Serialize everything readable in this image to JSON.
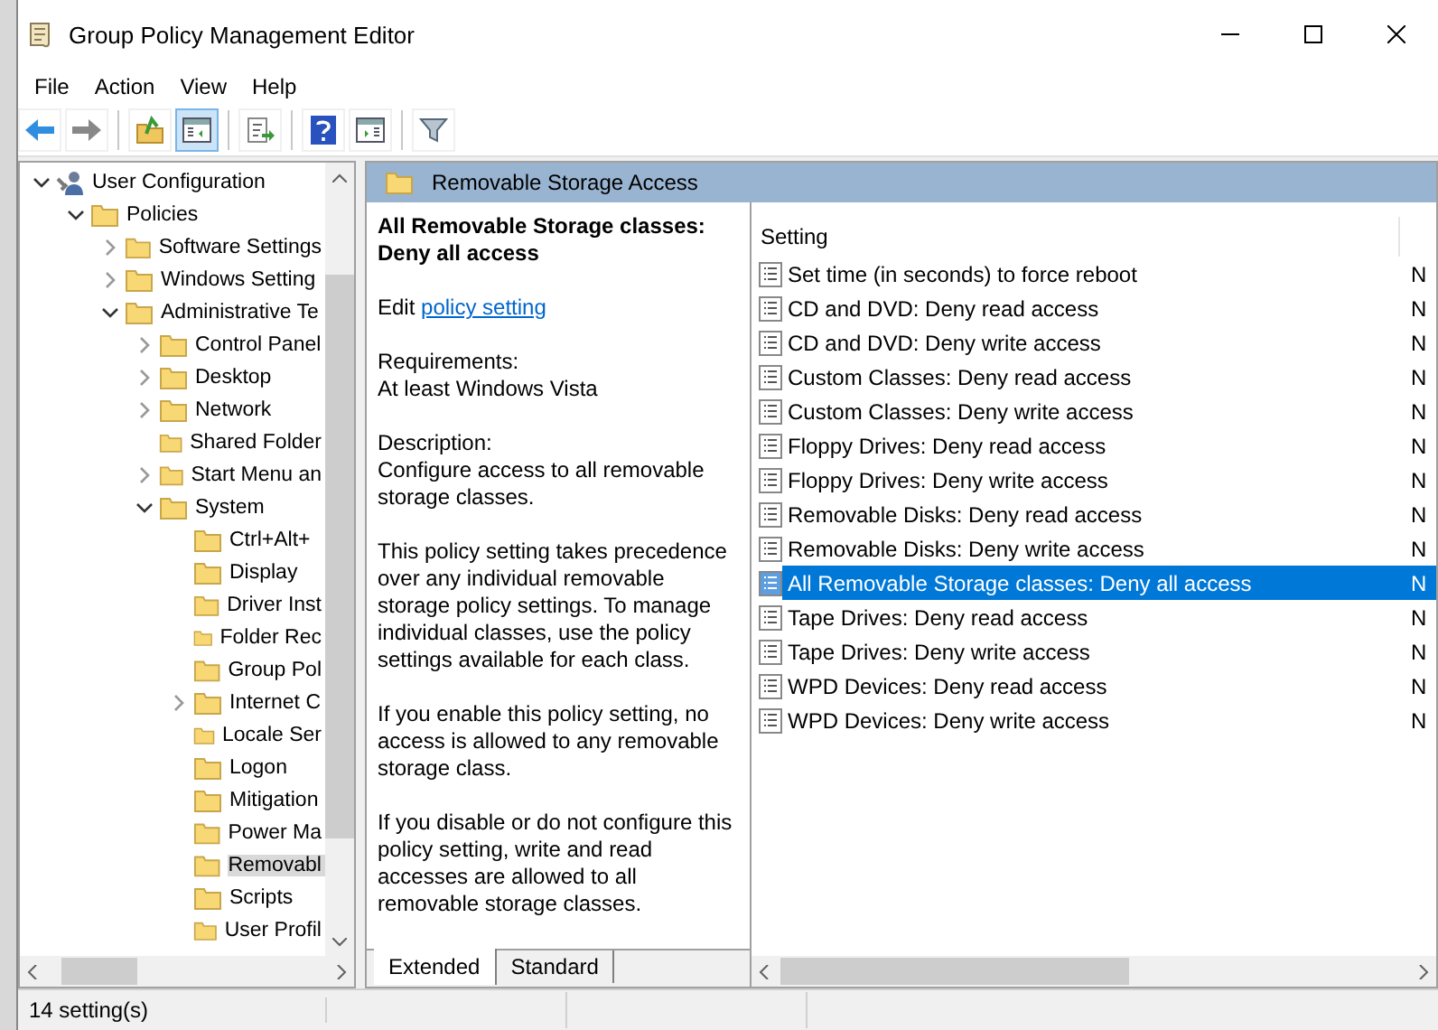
{
  "window": {
    "title": "Group Policy Management Editor"
  },
  "menu": [
    "File",
    "Action",
    "View",
    "Help"
  ],
  "toolbar": [
    [
      {
        "kind": "back",
        "pressed": false
      },
      {
        "kind": "forward",
        "pressed": false
      }
    ],
    [
      {
        "kind": "up",
        "pressed": false
      },
      {
        "kind": "tree",
        "pressed": true
      }
    ],
    [
      {
        "kind": "export",
        "pressed": false
      }
    ],
    [
      {
        "kind": "help",
        "pressed": false
      },
      {
        "kind": "panel",
        "pressed": false
      }
    ],
    [
      {
        "kind": "filter",
        "pressed": false
      }
    ]
  ],
  "tree": [
    {
      "label": "User Configuration",
      "kind": "user",
      "expandable": true,
      "expanded": true,
      "selected": false,
      "children": [
        {
          "label": "Policies",
          "kind": "folder",
          "expandable": true,
          "expanded": true,
          "selected": false,
          "children": [
            {
              "label": "Software Settings",
              "kind": "folder",
              "expandable": true,
              "expanded": false,
              "selected": false
            },
            {
              "label": "Windows Setting",
              "kind": "folder",
              "expandable": true,
              "expanded": false,
              "selected": false
            },
            {
              "label": "Administrative Te",
              "kind": "folder",
              "expandable": true,
              "expanded": true,
              "selected": false,
              "children": [
                {
                  "label": "Control Panel",
                  "kind": "folder",
                  "expandable": true,
                  "expanded": false,
                  "selected": false
                },
                {
                  "label": "Desktop",
                  "kind": "folder",
                  "expandable": true,
                  "expanded": false,
                  "selected": false
                },
                {
                  "label": "Network",
                  "kind": "folder",
                  "expandable": true,
                  "expanded": false,
                  "selected": false
                },
                {
                  "label": "Shared Folder",
                  "kind": "folder",
                  "expandable": false,
                  "selected": false
                },
                {
                  "label": "Start Menu an",
                  "kind": "folder",
                  "expandable": true,
                  "expanded": false,
                  "selected": false
                },
                {
                  "label": "System",
                  "kind": "folder",
                  "expandable": true,
                  "expanded": true,
                  "selected": false,
                  "children": [
                    {
                      "label": "Ctrl+Alt+",
                      "kind": "folder",
                      "expandable": false,
                      "selected": false
                    },
                    {
                      "label": "Display",
                      "kind": "folder",
                      "expandable": false,
                      "selected": false
                    },
                    {
                      "label": "Driver Inst",
                      "kind": "folder",
                      "expandable": false,
                      "selected": false
                    },
                    {
                      "label": "Folder Rec",
                      "kind": "folder",
                      "expandable": false,
                      "selected": false
                    },
                    {
                      "label": "Group Pol",
                      "kind": "folder",
                      "expandable": false,
                      "selected": false
                    },
                    {
                      "label": "Internet C",
                      "kind": "folder",
                      "expandable": true,
                      "expanded": false,
                      "selected": false
                    },
                    {
                      "label": "Locale Ser",
                      "kind": "folder",
                      "expandable": false,
                      "selected": false
                    },
                    {
                      "label": "Logon",
                      "kind": "folder",
                      "expandable": false,
                      "selected": false
                    },
                    {
                      "label": "Mitigation",
                      "kind": "folder",
                      "expandable": false,
                      "selected": false
                    },
                    {
                      "label": "Power Ma",
                      "kind": "folder",
                      "expandable": false,
                      "selected": false
                    },
                    {
                      "label": "Removabl",
                      "kind": "folder",
                      "expandable": false,
                      "selected": true
                    },
                    {
                      "label": "Scripts",
                      "kind": "folder",
                      "expandable": false,
                      "selected": false
                    },
                    {
                      "label": "User Profil",
                      "kind": "folder",
                      "expandable": false,
                      "selected": false
                    }
                  ]
                }
              ]
            }
          ]
        }
      ]
    }
  ],
  "header": {
    "title": "Removable Storage Access"
  },
  "description": {
    "title": "All Removable Storage classes: Deny all access",
    "edit_prefix": "Edit",
    "edit_link": "policy setting",
    "blocks": [
      [
        "Requirements:",
        "At least Windows Vista"
      ],
      [
        "Description:",
        "Configure access to all removable storage classes."
      ],
      [
        "This policy setting takes precedence over any individual removable storage policy settings. To manage individual classes, use the policy settings available for each class."
      ],
      [
        "If you enable this policy setting, no access is allowed to any removable storage class."
      ],
      [
        "If you disable or do not configure this policy setting, write and read accesses are allowed to all removable storage classes."
      ]
    ]
  },
  "tabs": [
    {
      "label": "Extended",
      "selected": true
    },
    {
      "label": "Standard",
      "selected": false
    }
  ],
  "settings": {
    "columns": [
      "Setting"
    ],
    "rows": [
      {
        "name": "Set time (in seconds) to force reboot",
        "state": "N",
        "selected": false
      },
      {
        "name": "CD and DVD: Deny read access",
        "state": "N",
        "selected": false
      },
      {
        "name": "CD and DVD: Deny write access",
        "state": "N",
        "selected": false
      },
      {
        "name": "Custom Classes: Deny read access",
        "state": "N",
        "selected": false
      },
      {
        "name": "Custom Classes: Deny write access",
        "state": "N",
        "selected": false
      },
      {
        "name": "Floppy Drives: Deny read access",
        "state": "N",
        "selected": false
      },
      {
        "name": "Floppy Drives: Deny write access",
        "state": "N",
        "selected": false
      },
      {
        "name": "Removable Disks: Deny read access",
        "state": "N",
        "selected": false
      },
      {
        "name": "Removable Disks: Deny write access",
        "state": "N",
        "selected": false
      },
      {
        "name": "All Removable Storage classes: Deny all access",
        "state": "N",
        "selected": true
      },
      {
        "name": "Tape Drives: Deny read access",
        "state": "N",
        "selected": false
      },
      {
        "name": "Tape Drives: Deny write access",
        "state": "N",
        "selected": false
      },
      {
        "name": "WPD Devices: Deny read access",
        "state": "N",
        "selected": false
      },
      {
        "name": "WPD Devices: Deny write access",
        "state": "N",
        "selected": false
      }
    ]
  },
  "status_bar": {
    "text": "14 setting(s)"
  }
}
